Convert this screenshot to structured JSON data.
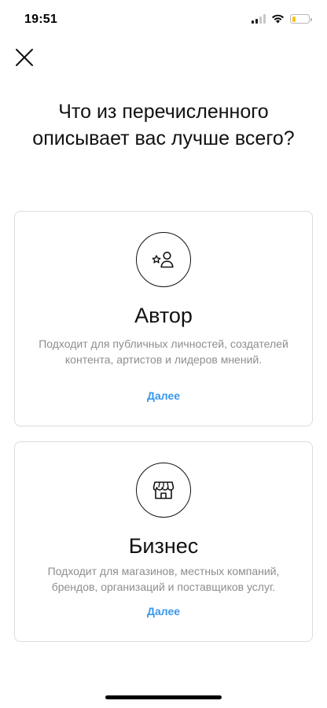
{
  "status_bar": {
    "time": "19:51",
    "signal_icon": "cellular-signal-icon",
    "wifi_icon": "wifi-icon",
    "battery_icon": "battery-icon",
    "battery_level": 0.2,
    "battery_color": "#f5c518"
  },
  "header": {
    "close_icon": "close-icon",
    "title": "Что из перечисленного описывает вас лучше всего?"
  },
  "options": [
    {
      "icon": "creator-star-person-icon",
      "title": "Автор",
      "description": "Подходит для публичных личностей, создателей контента, артистов и лидеров мнений.",
      "link_label": "Далее"
    },
    {
      "icon": "storefront-icon",
      "title": "Бизнес",
      "description": "Подходит для магазинов, местных компаний, брендов, организаций и поставщиков услуг.",
      "link_label": "Далее"
    }
  ],
  "colors": {
    "link": "#3897f0",
    "secondary_text": "#8e8e8e",
    "border": "#dcdcdc"
  }
}
